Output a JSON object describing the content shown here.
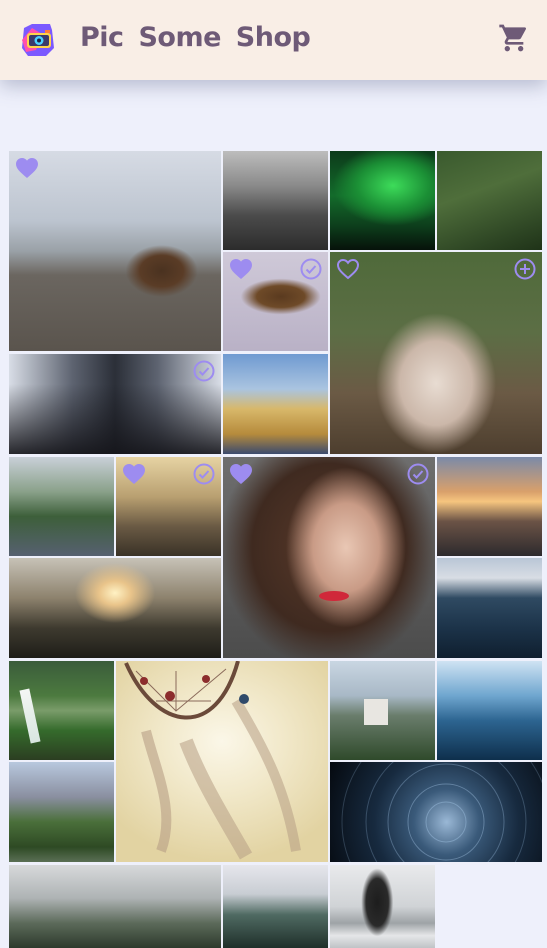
{
  "header": {
    "brand": "Pic Some Shop",
    "logo_icon": "camera-logo-icon",
    "cart_icon": "cart-icon"
  },
  "colors": {
    "header_bg": "#f9eee6",
    "brand_text": "#6e5a77",
    "page_bg": "#eef0fb",
    "overlay_icon": "#9d8cf0"
  },
  "photos": [
    {
      "subject": "marmot",
      "favorited": true,
      "selected": false,
      "in_cart_hint": false
    },
    {
      "subject": "foggy-forest",
      "favorited": false,
      "selected": false,
      "in_cart_hint": false
    },
    {
      "subject": "aurora",
      "favorited": false,
      "selected": false,
      "in_cart_hint": false
    },
    {
      "subject": "grass",
      "favorited": false,
      "selected": false,
      "in_cart_hint": false
    },
    {
      "subject": "eagle",
      "favorited": true,
      "selected": true,
      "in_cart_hint": false
    },
    {
      "subject": "pug-in-blanket",
      "favorited": true,
      "selected": false,
      "in_cart_hint": true
    },
    {
      "subject": "skyscraper",
      "favorited": false,
      "selected": true,
      "in_cart_hint": false
    },
    {
      "subject": "field-feet",
      "favorited": false,
      "selected": false,
      "in_cart_hint": false
    },
    {
      "subject": "city-park",
      "favorited": false,
      "selected": false,
      "in_cart_hint": false
    },
    {
      "subject": "swamp",
      "favorited": true,
      "selected": true,
      "in_cart_hint": false
    },
    {
      "subject": "woman-portrait",
      "favorited": true,
      "selected": true,
      "in_cart_hint": false
    },
    {
      "subject": "rail-sunset",
      "favorited": false,
      "selected": false,
      "in_cart_hint": false
    },
    {
      "subject": "valley-sunrise",
      "favorited": false,
      "selected": false,
      "in_cart_hint": false
    },
    {
      "subject": "sea-mountains",
      "favorited": false,
      "selected": false,
      "in_cart_hint": false
    },
    {
      "subject": "waterfall",
      "favorited": false,
      "selected": false,
      "in_cart_hint": false
    },
    {
      "subject": "dreamcatcher",
      "favorited": false,
      "selected": false,
      "in_cart_hint": false
    },
    {
      "subject": "castle",
      "favorited": false,
      "selected": false,
      "in_cart_hint": false
    },
    {
      "subject": "wave",
      "favorited": false,
      "selected": false,
      "in_cart_hint": false
    },
    {
      "subject": "yosemite",
      "favorited": false,
      "selected": false,
      "in_cart_hint": false
    },
    {
      "subject": "star-trails",
      "favorited": false,
      "selected": false,
      "in_cart_hint": false
    },
    {
      "subject": "misty-forest",
      "favorited": false,
      "selected": false,
      "in_cart_hint": false
    },
    {
      "subject": "snowy-mountain",
      "favorited": false,
      "selected": false,
      "in_cart_hint": false
    },
    {
      "subject": "sea-stack",
      "favorited": false,
      "selected": false,
      "in_cart_hint": false
    }
  ]
}
